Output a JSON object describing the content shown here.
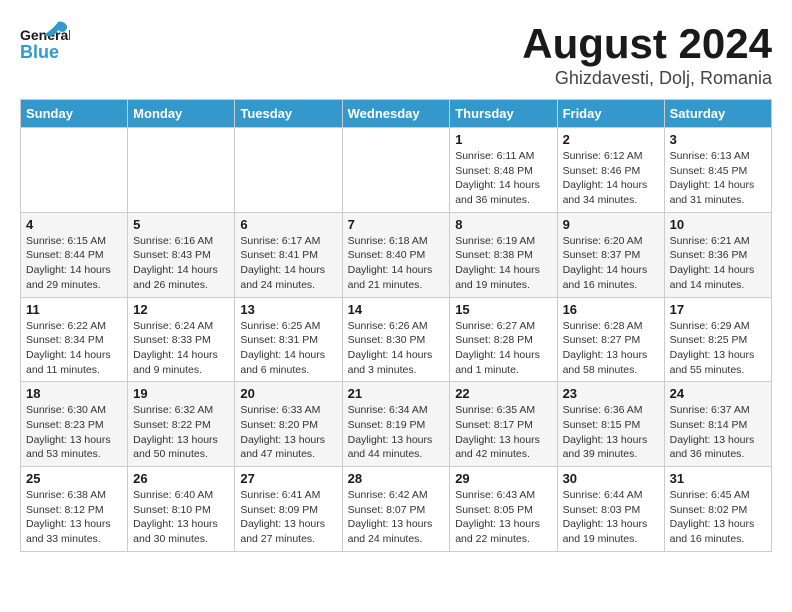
{
  "header": {
    "logo_general": "General",
    "logo_blue": "Blue",
    "month": "August 2024",
    "location": "Ghizdavesti, Dolj, Romania"
  },
  "days_of_week": [
    "Sunday",
    "Monday",
    "Tuesday",
    "Wednesday",
    "Thursday",
    "Friday",
    "Saturday"
  ],
  "weeks": [
    [
      {
        "day": "",
        "info": ""
      },
      {
        "day": "",
        "info": ""
      },
      {
        "day": "",
        "info": ""
      },
      {
        "day": "",
        "info": ""
      },
      {
        "day": "1",
        "info": "Sunrise: 6:11 AM\nSunset: 8:48 PM\nDaylight: 14 hours and 36 minutes."
      },
      {
        "day": "2",
        "info": "Sunrise: 6:12 AM\nSunset: 8:46 PM\nDaylight: 14 hours and 34 minutes."
      },
      {
        "day": "3",
        "info": "Sunrise: 6:13 AM\nSunset: 8:45 PM\nDaylight: 14 hours and 31 minutes."
      }
    ],
    [
      {
        "day": "4",
        "info": "Sunrise: 6:15 AM\nSunset: 8:44 PM\nDaylight: 14 hours and 29 minutes."
      },
      {
        "day": "5",
        "info": "Sunrise: 6:16 AM\nSunset: 8:43 PM\nDaylight: 14 hours and 26 minutes."
      },
      {
        "day": "6",
        "info": "Sunrise: 6:17 AM\nSunset: 8:41 PM\nDaylight: 14 hours and 24 minutes."
      },
      {
        "day": "7",
        "info": "Sunrise: 6:18 AM\nSunset: 8:40 PM\nDaylight: 14 hours and 21 minutes."
      },
      {
        "day": "8",
        "info": "Sunrise: 6:19 AM\nSunset: 8:38 PM\nDaylight: 14 hours and 19 minutes."
      },
      {
        "day": "9",
        "info": "Sunrise: 6:20 AM\nSunset: 8:37 PM\nDaylight: 14 hours and 16 minutes."
      },
      {
        "day": "10",
        "info": "Sunrise: 6:21 AM\nSunset: 8:36 PM\nDaylight: 14 hours and 14 minutes."
      }
    ],
    [
      {
        "day": "11",
        "info": "Sunrise: 6:22 AM\nSunset: 8:34 PM\nDaylight: 14 hours and 11 minutes."
      },
      {
        "day": "12",
        "info": "Sunrise: 6:24 AM\nSunset: 8:33 PM\nDaylight: 14 hours and 9 minutes."
      },
      {
        "day": "13",
        "info": "Sunrise: 6:25 AM\nSunset: 8:31 PM\nDaylight: 14 hours and 6 minutes."
      },
      {
        "day": "14",
        "info": "Sunrise: 6:26 AM\nSunset: 8:30 PM\nDaylight: 14 hours and 3 minutes."
      },
      {
        "day": "15",
        "info": "Sunrise: 6:27 AM\nSunset: 8:28 PM\nDaylight: 14 hours and 1 minute."
      },
      {
        "day": "16",
        "info": "Sunrise: 6:28 AM\nSunset: 8:27 PM\nDaylight: 13 hours and 58 minutes."
      },
      {
        "day": "17",
        "info": "Sunrise: 6:29 AM\nSunset: 8:25 PM\nDaylight: 13 hours and 55 minutes."
      }
    ],
    [
      {
        "day": "18",
        "info": "Sunrise: 6:30 AM\nSunset: 8:23 PM\nDaylight: 13 hours and 53 minutes."
      },
      {
        "day": "19",
        "info": "Sunrise: 6:32 AM\nSunset: 8:22 PM\nDaylight: 13 hours and 50 minutes."
      },
      {
        "day": "20",
        "info": "Sunrise: 6:33 AM\nSunset: 8:20 PM\nDaylight: 13 hours and 47 minutes."
      },
      {
        "day": "21",
        "info": "Sunrise: 6:34 AM\nSunset: 8:19 PM\nDaylight: 13 hours and 44 minutes."
      },
      {
        "day": "22",
        "info": "Sunrise: 6:35 AM\nSunset: 8:17 PM\nDaylight: 13 hours and 42 minutes."
      },
      {
        "day": "23",
        "info": "Sunrise: 6:36 AM\nSunset: 8:15 PM\nDaylight: 13 hours and 39 minutes."
      },
      {
        "day": "24",
        "info": "Sunrise: 6:37 AM\nSunset: 8:14 PM\nDaylight: 13 hours and 36 minutes."
      }
    ],
    [
      {
        "day": "25",
        "info": "Sunrise: 6:38 AM\nSunset: 8:12 PM\nDaylight: 13 hours and 33 minutes."
      },
      {
        "day": "26",
        "info": "Sunrise: 6:40 AM\nSunset: 8:10 PM\nDaylight: 13 hours and 30 minutes."
      },
      {
        "day": "27",
        "info": "Sunrise: 6:41 AM\nSunset: 8:09 PM\nDaylight: 13 hours and 27 minutes."
      },
      {
        "day": "28",
        "info": "Sunrise: 6:42 AM\nSunset: 8:07 PM\nDaylight: 13 hours and 24 minutes."
      },
      {
        "day": "29",
        "info": "Sunrise: 6:43 AM\nSunset: 8:05 PM\nDaylight: 13 hours and 22 minutes."
      },
      {
        "day": "30",
        "info": "Sunrise: 6:44 AM\nSunset: 8:03 PM\nDaylight: 13 hours and 19 minutes."
      },
      {
        "day": "31",
        "info": "Sunrise: 6:45 AM\nSunset: 8:02 PM\nDaylight: 13 hours and 16 minutes."
      }
    ]
  ]
}
